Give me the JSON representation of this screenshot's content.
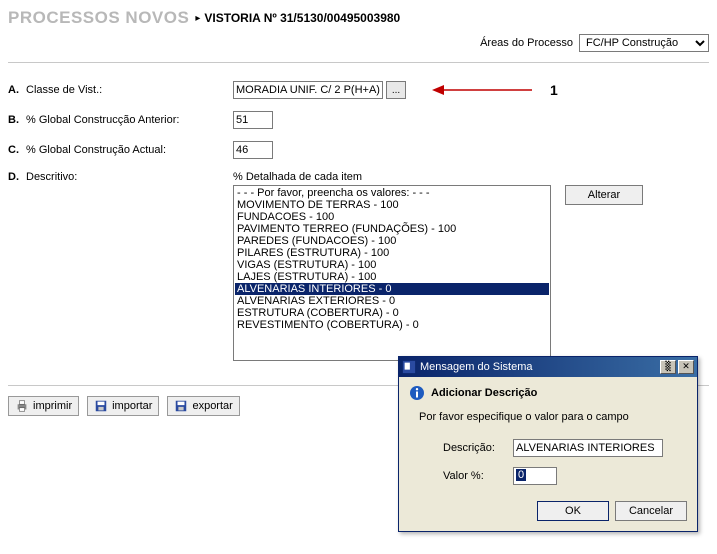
{
  "header": {
    "page_title_grey": "PROCESSOS NOVOS",
    "page_title_black": "VISTORIA Nº 31/5130/00495003980",
    "areas_label": "Áreas do Processo",
    "areas_value": "FC/HP Construção"
  },
  "form": {
    "a": {
      "letter": "A.",
      "label": "Classe de Vist.:",
      "value": "MORADIA UNIF. C/ 2 P(H+A)"
    },
    "b": {
      "letter": "B.",
      "label": "% Global Construcção Anterior:",
      "value": "51"
    },
    "c": {
      "letter": "C.",
      "label": "% Global Construção Actual:",
      "value": "46"
    },
    "d": {
      "letter": "D.",
      "label": "Descritivo:",
      "sublabel": "% Detalhada de cada item"
    }
  },
  "annotation": {
    "number": "1"
  },
  "detail_items": [
    "- - - Por favor, preencha os valores: - - -",
    "MOVIMENTO DE TERRAS - 100",
    "FUNDACOES - 100",
    "PAVIMENTO TERREO (FUNDAÇÕES) - 100",
    "PAREDES (FUNDACOES) - 100",
    "PILARES (ESTRUTURA) - 100",
    "VIGAS (ESTRUTURA) - 100",
    "LAJES (ESTRUTURA) - 100",
    "ALVENARIAS INTERIORES - 0",
    "ALVENARIAS EXTERIORES - 0",
    "ESTRUTURA (COBERTURA) - 0",
    "REVESTIMENTO (COBERTURA) - 0"
  ],
  "detail_selected_index": 8,
  "buttons": {
    "alterar": "Alterar",
    "imprimir": "imprimir",
    "importar": "importar",
    "exportar": "exportar"
  },
  "dialog": {
    "title": "Mensagem do Sistema",
    "heading": "Adicionar Descrição",
    "message": "Por favor especifique o valor para o campo",
    "desc_label": "Descrição:",
    "desc_value": "ALVENARIAS INTERIORES",
    "valor_label": "Valor %:",
    "valor_value": "0",
    "ok": "OK",
    "cancel": "Cancelar"
  }
}
